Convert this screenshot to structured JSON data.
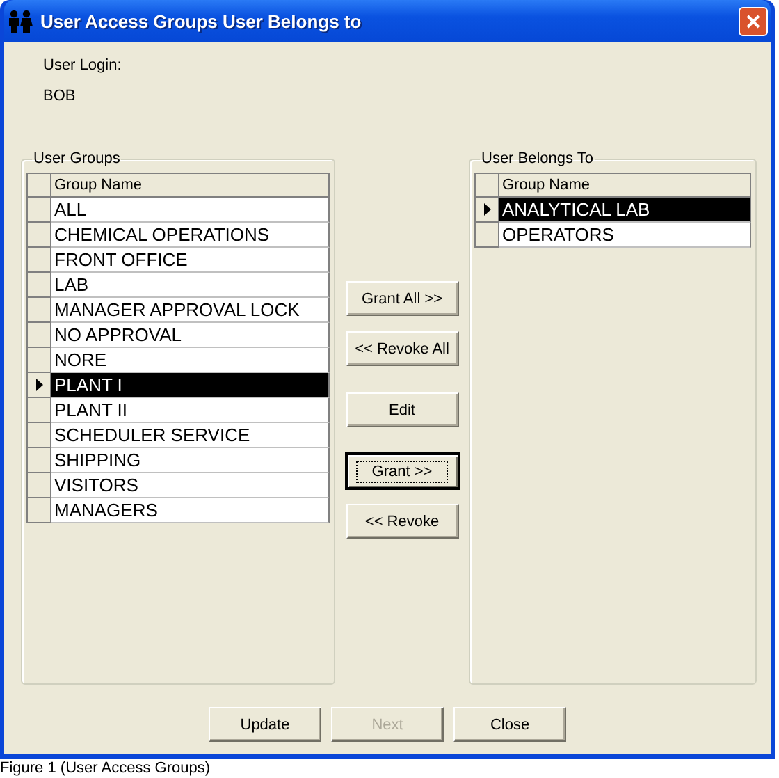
{
  "window": {
    "title": "User Access Groups User Belongs to"
  },
  "user_login": {
    "label": "User Login:",
    "value": "BOB"
  },
  "user_groups": {
    "title": "User Groups",
    "column": "Group Name",
    "rows": [
      {
        "name": "ALL",
        "selected": false
      },
      {
        "name": "CHEMICAL OPERATIONS",
        "selected": false
      },
      {
        "name": "FRONT OFFICE",
        "selected": false
      },
      {
        "name": "LAB",
        "selected": false
      },
      {
        "name": "MANAGER APPROVAL LOCK",
        "selected": false
      },
      {
        "name": "NO APPROVAL",
        "selected": false
      },
      {
        "name": "NORE",
        "selected": false
      },
      {
        "name": "PLANT I",
        "selected": true
      },
      {
        "name": "PLANT II",
        "selected": false
      },
      {
        "name": "SCHEDULER SERVICE",
        "selected": false
      },
      {
        "name": "SHIPPING",
        "selected": false
      },
      {
        "name": "VISITORS",
        "selected": false
      },
      {
        "name": "MANAGERS",
        "selected": false
      }
    ]
  },
  "user_belongs_to": {
    "title": "User Belongs To",
    "column": "Group Name",
    "rows": [
      {
        "name": "ANALYTICAL LAB",
        "selected": true
      },
      {
        "name": "OPERATORS",
        "selected": false
      }
    ]
  },
  "middle_buttons": [
    {
      "label": "Grant All >>",
      "focused": false
    },
    {
      "label": "<< Revoke All",
      "focused": false
    },
    {
      "label": "Edit",
      "focused": false
    },
    {
      "label": "Grant >>",
      "focused": true
    },
    {
      "label": "<< Revoke",
      "focused": false
    }
  ],
  "bottom_buttons": [
    {
      "label": "Update",
      "disabled": false
    },
    {
      "label": "Next",
      "disabled": true
    },
    {
      "label": "Close",
      "disabled": false
    }
  ],
  "caption": "Figure 1 (User Access Groups)"
}
